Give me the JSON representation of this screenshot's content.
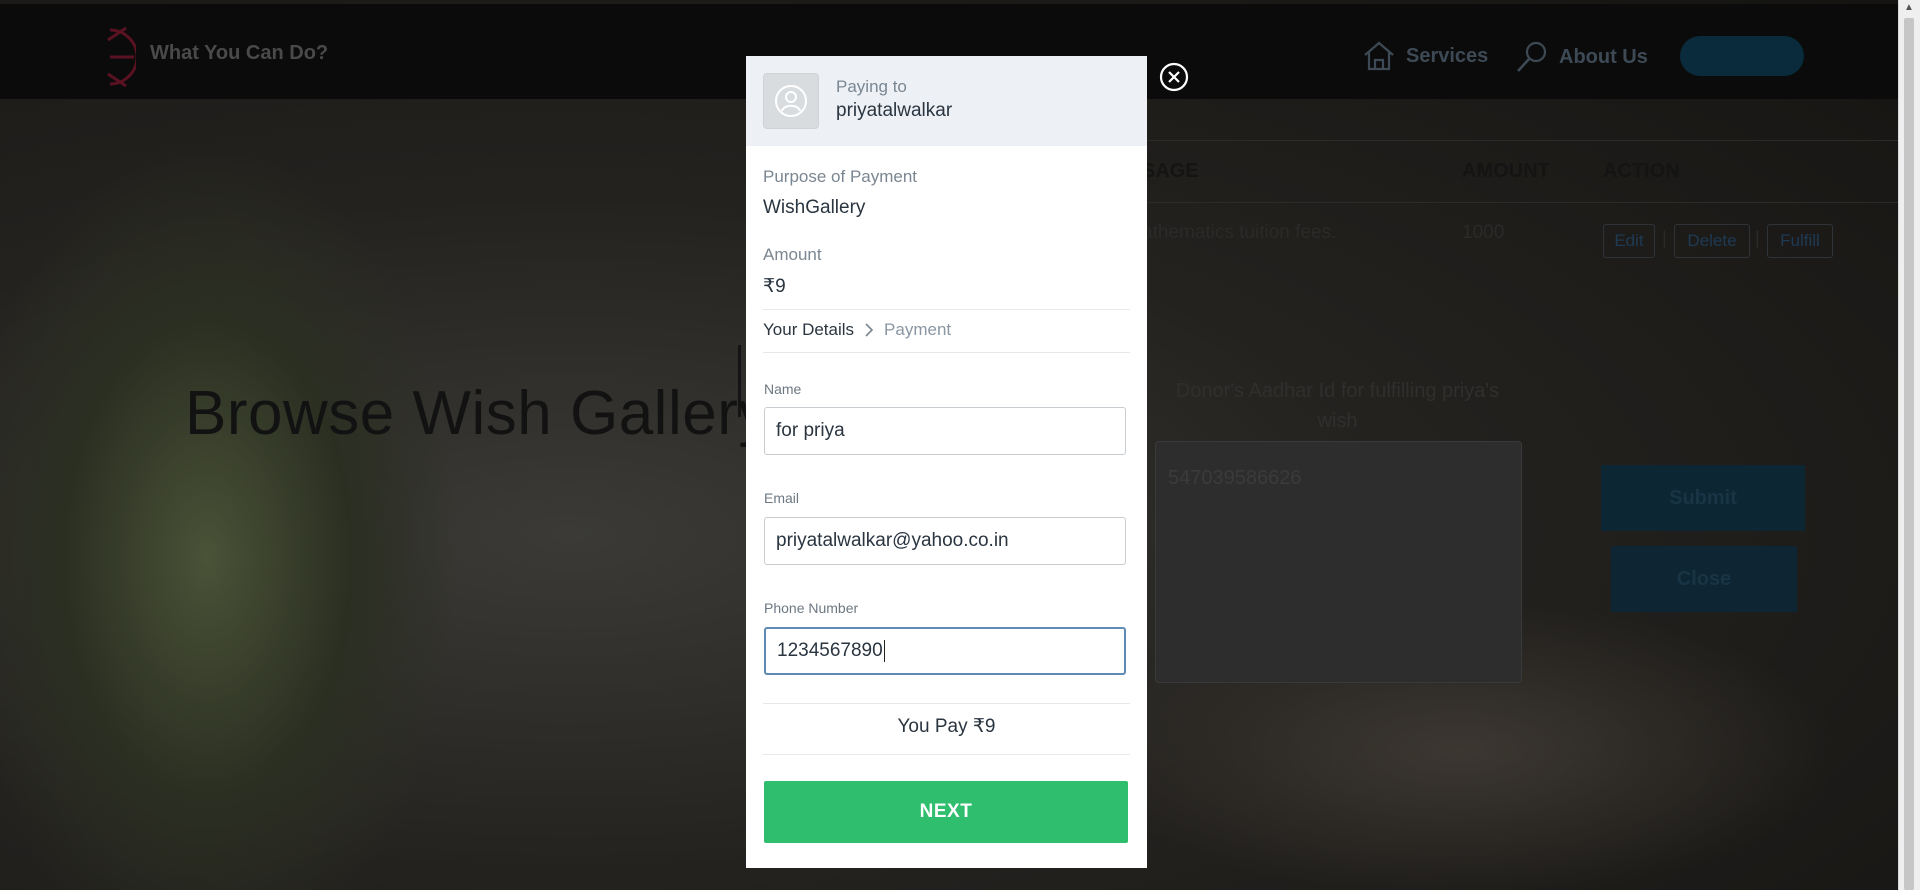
{
  "nav": {
    "brand": "What You Can Do?",
    "services": "Services",
    "about": "About Us"
  },
  "table": {
    "headers": {
      "message": "SAGE",
      "amount": "AMOUNT",
      "action": "ACTION"
    },
    "row": {
      "message": "athematics tuition fees.",
      "amount": "1000",
      "edit": "Edit",
      "delete": "Delete",
      "fulfill": "Fulfill",
      "separator": "|"
    }
  },
  "hero": {
    "title": "Browse Wish Gallery"
  },
  "fulfill_form": {
    "aadhar_label": "Donor's Aadhar Id for fulfilling priya's wish",
    "aadhar_value": "547039586626",
    "submit": "Submit",
    "close": "Close"
  },
  "modal": {
    "paying_to_label": "Paying to",
    "payee": "priyatalwalkar",
    "purpose_label": "Purpose of Payment",
    "purpose_value": "WishGallery",
    "amount_label": "Amount",
    "amount_value": "₹9",
    "steps": {
      "current": "Your Details",
      "next": "Payment"
    },
    "fields": {
      "name_label": "Name",
      "name_value": "for priya",
      "email_label": "Email",
      "email_value": "priyatalwalkar@yahoo.co.in",
      "phone_label": "Phone Number",
      "phone_value": "1234567890"
    },
    "you_pay": "You Pay ₹9",
    "next": "NEXT"
  }
}
